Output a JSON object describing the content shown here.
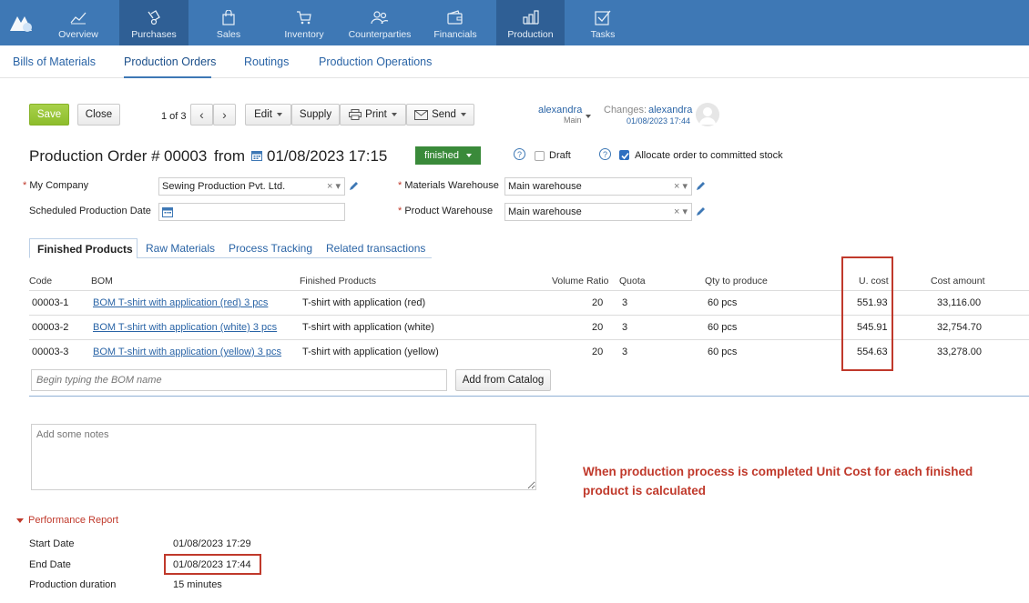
{
  "nav": {
    "items": [
      {
        "label": "Overview",
        "icon": "chart-line-icon"
      },
      {
        "label": "Purchases",
        "icon": "purchases-icon"
      },
      {
        "label": "Sales",
        "icon": "shopping-bag-icon"
      },
      {
        "label": "Inventory",
        "icon": "cart-icon"
      },
      {
        "label": "Counterparties",
        "icon": "people-icon"
      },
      {
        "label": "Financials",
        "icon": "wallet-icon"
      },
      {
        "label": "Production",
        "icon": "factory-icon"
      },
      {
        "label": "Tasks",
        "icon": "checkbox-icon"
      }
    ],
    "active_items": [
      "Purchases",
      "Production"
    ]
  },
  "subnav": {
    "items": [
      "Bills of Materials",
      "Production Orders",
      "Routings",
      "Production Operations"
    ],
    "active": "Production Orders"
  },
  "toolbar": {
    "save": "Save",
    "close": "Close",
    "pager": "1 of 3",
    "edit": "Edit",
    "supply": "Supply",
    "print": "Print",
    "send": "Send",
    "owner_name": "alexandra",
    "owner_group": "Main",
    "changes_label": "Changes:",
    "changes_user": "alexandra",
    "changes_time": "01/08/2023 17:44"
  },
  "order": {
    "title_prefix": "Production Order #",
    "number": "00003",
    "from_label": "from",
    "date": "01/08/2023 17:15",
    "status": "finished",
    "draft_label": "Draft",
    "draft_checked": false,
    "allocate_label": "Allocate order to committed stock",
    "allocate_checked": true
  },
  "form": {
    "my_company_label": "My Company",
    "my_company_value": "Sewing Production Pvt. Ltd.",
    "scheduled_label": "Scheduled Production Date",
    "scheduled_value": "",
    "materials_wh_label": "Materials Warehouse",
    "materials_wh_value": "Main warehouse",
    "product_wh_label": "Product Warehouse",
    "product_wh_value": "Main warehouse"
  },
  "tabs": [
    "Finished Products",
    "Raw Materials",
    "Process Tracking",
    "Related transactions"
  ],
  "table": {
    "headers": [
      "Code",
      "BOM",
      "Finished Products",
      "Volume Ratio",
      "Quota",
      "Qty to produce",
      "U. cost",
      "Cost amount"
    ],
    "rows": [
      {
        "code": "00003-1",
        "bom": "BOM T-shirt with application (red) 3 pcs",
        "product": "T-shirt with application (red)",
        "ratio": "20",
        "quota": "3",
        "qty": "60 pcs",
        "ucost": "551.93",
        "amount": "33,116.00"
      },
      {
        "code": "00003-2",
        "bom": "BOM T-shirt with application (white) 3 pcs",
        "product": "T-shirt with application (white)",
        "ratio": "20",
        "quota": "3",
        "qty": "60 pcs",
        "ucost": "545.91",
        "amount": "32,754.70"
      },
      {
        "code": "00003-3",
        "bom": "BOM T-shirt with application (yellow) 3 pcs",
        "product": "T-shirt with application (yellow)",
        "ratio": "20",
        "quota": "3",
        "qty": "60 pcs",
        "ucost": "554.63",
        "amount": "33,278.00"
      }
    ],
    "bom_placeholder": "Begin typing the BOM name",
    "add_catalog": "Add from Catalog"
  },
  "notes_placeholder": "Add some notes",
  "annotation": "When production process is completed Unit Cost for each finished product is calculated",
  "performance": {
    "title": "Performance Report",
    "start_label": "Start Date",
    "start_value": "01/08/2023 17:29",
    "end_label": "End Date",
    "end_value": "01/08/2023 17:44",
    "duration_label": "Production duration",
    "duration_value": "15 minutes"
  },
  "colors": {
    "nav_bg": "#3e78b5",
    "nav_active": "#2f5f95",
    "save_green": "#8dbd2c",
    "status_green": "#3a8a3a",
    "highlight_red": "#c0392b"
  }
}
